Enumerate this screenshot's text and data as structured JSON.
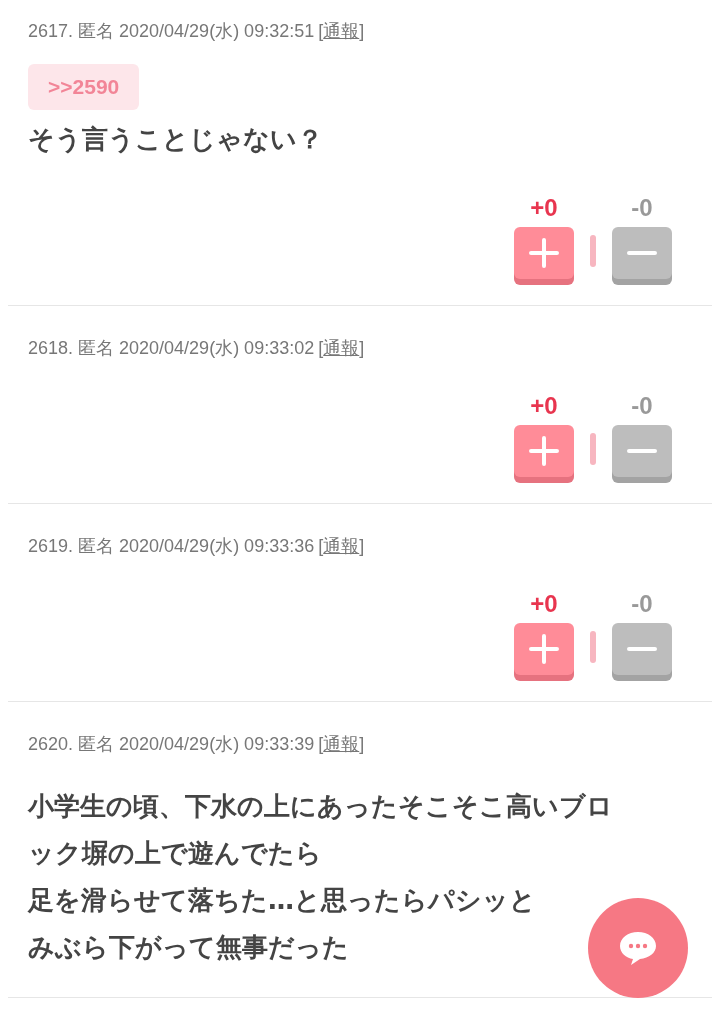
{
  "posts": [
    {
      "header": "2617. 匿名 2020/04/29(水) 09:32:51",
      "report": "[通報]",
      "reply": ">>2590",
      "body": [
        "そう言うことじゃない？"
      ],
      "votes": {
        "plus": "+0",
        "minus": "-0"
      }
    },
    {
      "header": "2618. 匿名 2020/04/29(水) 09:33:02",
      "report": "[通報]",
      "votes": {
        "plus": "+0",
        "minus": "-0"
      }
    },
    {
      "header": "2619. 匿名 2020/04/29(水) 09:33:36",
      "report": "[通報]",
      "votes": {
        "plus": "+0",
        "minus": "-0"
      }
    },
    {
      "header": "2620. 匿名 2020/04/29(水) 09:33:39",
      "report": "[通報]",
      "body": [
        "小学生の頃、下水の上にあったそこそこ高いブロ",
        "ック塀の上で遊んでたら",
        "足を滑らせて落ちた…と思ったらパシッと",
        "みぶら下がって無事だった"
      ]
    }
  ]
}
